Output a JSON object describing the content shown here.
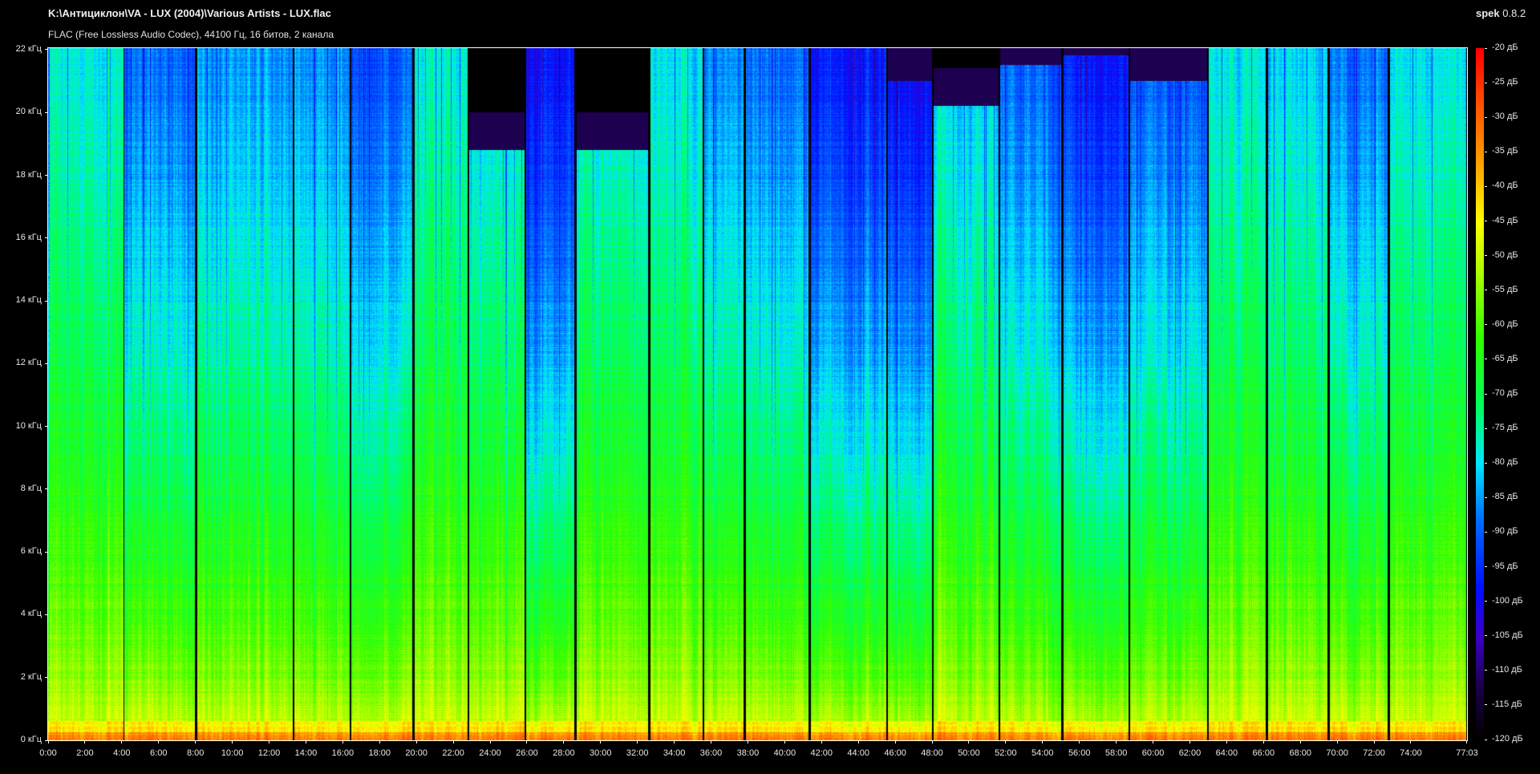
{
  "header": {
    "file_path": "K:\\Антициклон\\VA - LUX (2004)\\Various Artists - LUX.flac",
    "stream_info": "FLAC (Free Lossless Audio Codec), 44100 Гц, 16 битов, 2 канала",
    "app_name": "spek",
    "app_version": "0.8.2"
  },
  "chart_data": {
    "type": "heatmap",
    "title": "K:\\Антициклон\\VA - LUX (2004)\\Various Artists - LUX.flac",
    "subtitle": "FLAC (Free Lossless Audio Codec), 44100 Гц, 16 битов, 2 канала",
    "x_unit": "minutes",
    "x_range": [
      0,
      77.05
    ],
    "x_ticks": [
      "0:00",
      "2:00",
      "4:00",
      "6:00",
      "8:00",
      "10:00",
      "12:00",
      "14:00",
      "16:00",
      "18:00",
      "20:00",
      "22:00",
      "24:00",
      "26:00",
      "28:00",
      "30:00",
      "32:00",
      "34:00",
      "36:00",
      "38:00",
      "40:00",
      "42:00",
      "44:00",
      "46:00",
      "48:00",
      "50:00",
      "52:00",
      "54:00",
      "56:00",
      "58:00",
      "60:00",
      "62:00",
      "64:00",
      "66:00",
      "68:00",
      "70:00",
      "72:00",
      "74:00"
    ],
    "x_end_label": "77:03",
    "y_unit": "kHz",
    "y_range": [
      0,
      22.05
    ],
    "y_ticks": [
      "0 кГц",
      "2 кГц",
      "4 кГц",
      "6 кГц",
      "8 кГц",
      "10 кГц",
      "12 кГц",
      "14 кГц",
      "16 кГц",
      "18 кГц",
      "20 кГц",
      "22 кГц"
    ],
    "colorbar": {
      "range_db": [
        -120,
        -20
      ],
      "labels": [
        "-20 дБ",
        "-25 дБ",
        "-30 дБ",
        "-35 дБ",
        "-40 дБ",
        "-45 дБ",
        "-50 дБ",
        "-55 дБ",
        "-60 дБ",
        "-65 дБ",
        "-70 дБ",
        "-75 дБ",
        "-80 дБ",
        "-85 дБ",
        "-90 дБ",
        "-95 дБ",
        "-100 дБ",
        "-105 дБ",
        "-110 дБ",
        "-115 дБ",
        "-120 дБ"
      ],
      "stops": [
        {
          "db": -120,
          "color": "#000000"
        },
        {
          "db": -112,
          "color": "#1e0050"
        },
        {
          "db": -105,
          "color": "#3a00c8"
        },
        {
          "db": -98,
          "color": "#0010ff"
        },
        {
          "db": -88,
          "color": "#0070ff"
        },
        {
          "db": -80,
          "color": "#00e8ff"
        },
        {
          "db": -72,
          "color": "#00ff60"
        },
        {
          "db": -62,
          "color": "#30ff00"
        },
        {
          "db": -52,
          "color": "#b0ff00"
        },
        {
          "db": -45,
          "color": "#ffff00"
        },
        {
          "db": -38,
          "color": "#ffb000"
        },
        {
          "db": -28,
          "color": "#ff5000"
        },
        {
          "db": -20,
          "color": "#ff0000"
        }
      ]
    },
    "tracks": [
      {
        "start_min": 0.0,
        "cutoff_khz": 22.05,
        "high_db": -78
      },
      {
        "start_min": 4.06,
        "cutoff_khz": 22.05,
        "high_db": -90
      },
      {
        "start_min": 8.01,
        "cutoff_khz": 22.05,
        "high_db": -86
      },
      {
        "start_min": 13.3,
        "cutoff_khz": 22.05,
        "high_db": -86
      },
      {
        "start_min": 16.39,
        "cutoff_khz": 22.05,
        "high_db": -92
      },
      {
        "start_min": 19.81,
        "cutoff_khz": 22.05,
        "high_db": -78
      },
      {
        "start_min": 22.8,
        "cutoff_khz": 18.8,
        "high_db": -82
      },
      {
        "start_min": 25.9,
        "cutoff_khz": 22.05,
        "high_db": -100
      },
      {
        "start_min": 28.62,
        "cutoff_khz": 18.8,
        "high_db": -80
      },
      {
        "start_min": 32.63,
        "cutoff_khz": 22.05,
        "high_db": -80
      },
      {
        "start_min": 35.56,
        "cutoff_khz": 22.05,
        "high_db": -88
      },
      {
        "start_min": 37.81,
        "cutoff_khz": 22.05,
        "high_db": -90
      },
      {
        "start_min": 41.33,
        "cutoff_khz": 22.05,
        "high_db": -98
      },
      {
        "start_min": 45.55,
        "cutoff_khz": 21.0,
        "high_db": -100
      },
      {
        "start_min": 48.01,
        "cutoff_khz": 20.2,
        "high_db": -82
      },
      {
        "start_min": 51.64,
        "cutoff_khz": 21.5,
        "high_db": -90
      },
      {
        "start_min": 55.05,
        "cutoff_khz": 21.8,
        "high_db": -98
      },
      {
        "start_min": 58.69,
        "cutoff_khz": 21.0,
        "high_db": -92
      },
      {
        "start_min": 62.96,
        "cutoff_khz": 22.05,
        "high_db": -80
      },
      {
        "start_min": 66.16,
        "cutoff_khz": 22.05,
        "high_db": -82
      },
      {
        "start_min": 69.52,
        "cutoff_khz": 22.05,
        "high_db": -90
      },
      {
        "start_min": 72.78,
        "cutoff_khz": 22.05,
        "high_db": -80
      }
    ]
  }
}
